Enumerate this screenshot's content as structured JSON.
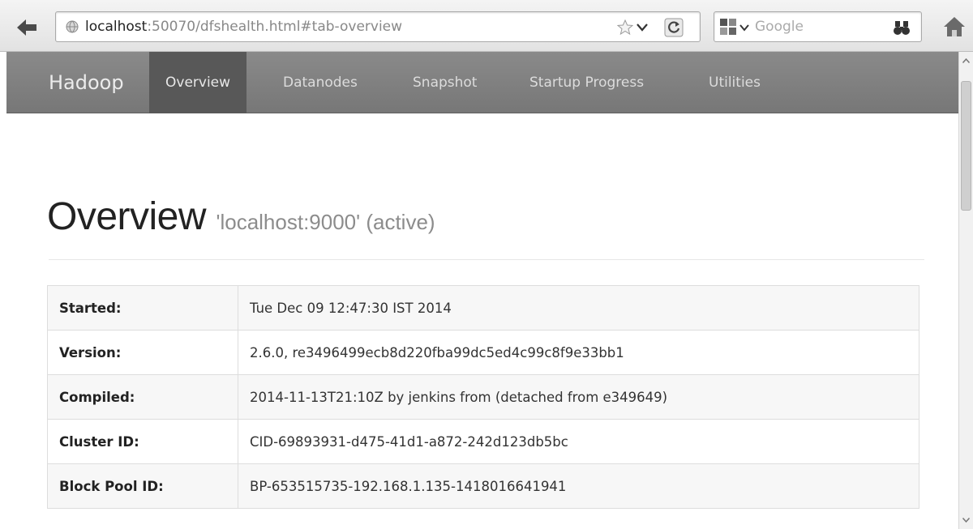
{
  "browser": {
    "url_host": "localhost",
    "url_rest": ":50070/dfshealth.html#tab-overview",
    "search_placeholder": "Google"
  },
  "navbar": {
    "brand": "Hadoop",
    "items": [
      {
        "label": "Overview",
        "active": true
      },
      {
        "label": "Datanodes",
        "active": false
      },
      {
        "label": "Snapshot",
        "active": false
      },
      {
        "label": "Startup Progress",
        "active": false
      },
      {
        "label": "Utilities",
        "active": false
      }
    ]
  },
  "overview": {
    "title": "Overview",
    "subtitle": "'localhost:9000' (active)",
    "rows": [
      {
        "label": "Started:",
        "value": "Tue Dec 09 12:47:30 IST 2014"
      },
      {
        "label": "Version:",
        "value": "2.6.0, re3496499ecb8d220fba99dc5ed4c99c8f9e33bb1"
      },
      {
        "label": "Compiled:",
        "value": "2014-11-13T21:10Z by jenkins from (detached from e349649)"
      },
      {
        "label": "Cluster ID:",
        "value": "CID-69893931-d475-41d1-a872-242d123db5bc"
      },
      {
        "label": "Block Pool ID:",
        "value": "BP-653515735-192.168.1.135-1418016641941"
      }
    ]
  },
  "icons": {
    "back": "arrow-left-icon",
    "globe": "globe-icon",
    "star": "star-icon",
    "reload": "reload-icon",
    "search_engine": "google-icon",
    "search_go": "binoculars-icon",
    "home": "home-icon"
  }
}
